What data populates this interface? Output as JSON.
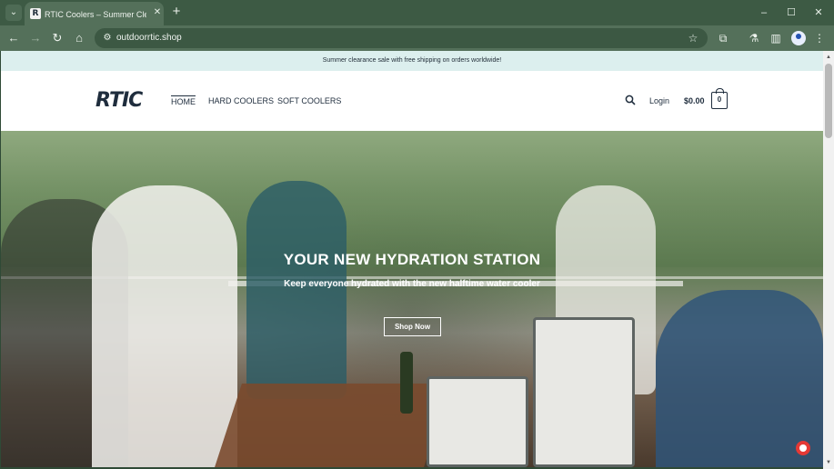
{
  "browser": {
    "tab_title": "RTIC Coolers – Summer Clearance",
    "favicon_letter": "R",
    "url": "outdoorrtic.shop",
    "icons": [
      "tab-search-icon",
      "close-icon",
      "new-tab-icon",
      "minimize-icon",
      "maximize-icon",
      "window-close-icon",
      "back-icon",
      "forward-icon",
      "reload-icon",
      "home-icon",
      "site-info-icon",
      "bookmark-star-icon",
      "extensions-icon",
      "labs-icon",
      "side-panel-icon",
      "profile-icon",
      "menu-icon"
    ]
  },
  "site": {
    "announcement": "Summer clearance sale with free shipping on orders worldwide!",
    "logo_text": "RTIC",
    "nav": {
      "home": "HOME",
      "hard_coolers": "HARD COOLERS",
      "soft_coolers": "SOFT COOLERS"
    },
    "login": "Login",
    "cart_total": "$0.00",
    "cart_count": "0",
    "accent": "#1f2d3d",
    "announce_bg": "#dcefee"
  },
  "hero": {
    "title": "YOUR NEW HYDRATION STATION",
    "subtitle": "Keep everyone hydrated with the new halftime water cooler",
    "button": "Shop Now"
  }
}
